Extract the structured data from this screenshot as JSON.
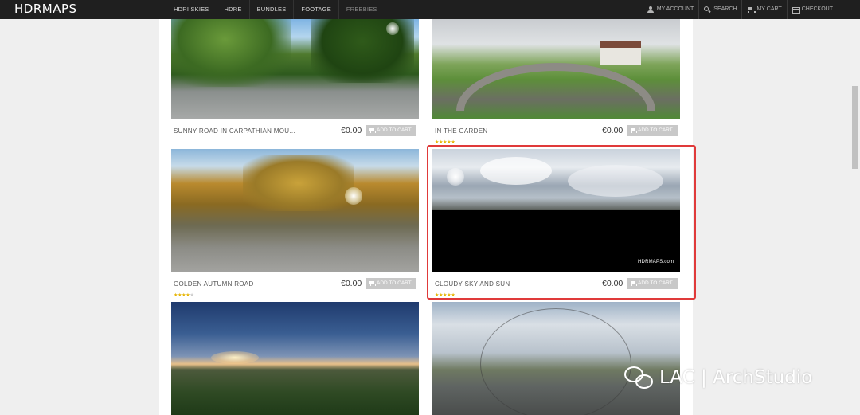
{
  "brand": {
    "logo": "HDRMAPS"
  },
  "nav": {
    "items": [
      "HDRI SKIES",
      "HDRE",
      "BUNDLES",
      "FOOTAGE",
      "FREEBIES"
    ]
  },
  "account": {
    "my_account": "MY ACCOUNT",
    "search": "SEARCH",
    "my_cart": "MY CART",
    "checkout": "CHECKOUT"
  },
  "products": [
    {
      "title": "SUNNY ROAD IN CARPATHIAN MOU...",
      "price": "€0.00",
      "cart_label": "ADD TO CART",
      "rating": 0
    },
    {
      "title": "IN THE GARDEN",
      "price": "€0.00",
      "cart_label": "ADD TO CART",
      "rating": 5
    },
    {
      "title": "GOLDEN AUTUMN ROAD",
      "price": "€0.00",
      "cart_label": "ADD TO CART",
      "rating": 4
    },
    {
      "title": "CLOUDY SKY AND SUN",
      "price": "€0.00",
      "cart_label": "ADD TO CART",
      "rating": 5,
      "watermark": "HDRMAPS.com"
    },
    {
      "title": "",
      "price": "",
      "cart_label": "",
      "rating": 0
    },
    {
      "title": "",
      "price": "",
      "cart_label": "",
      "rating": 0
    }
  ],
  "highlight_color": "#e03a3a",
  "overlay": {
    "text": "LAC | ArchStudio"
  }
}
